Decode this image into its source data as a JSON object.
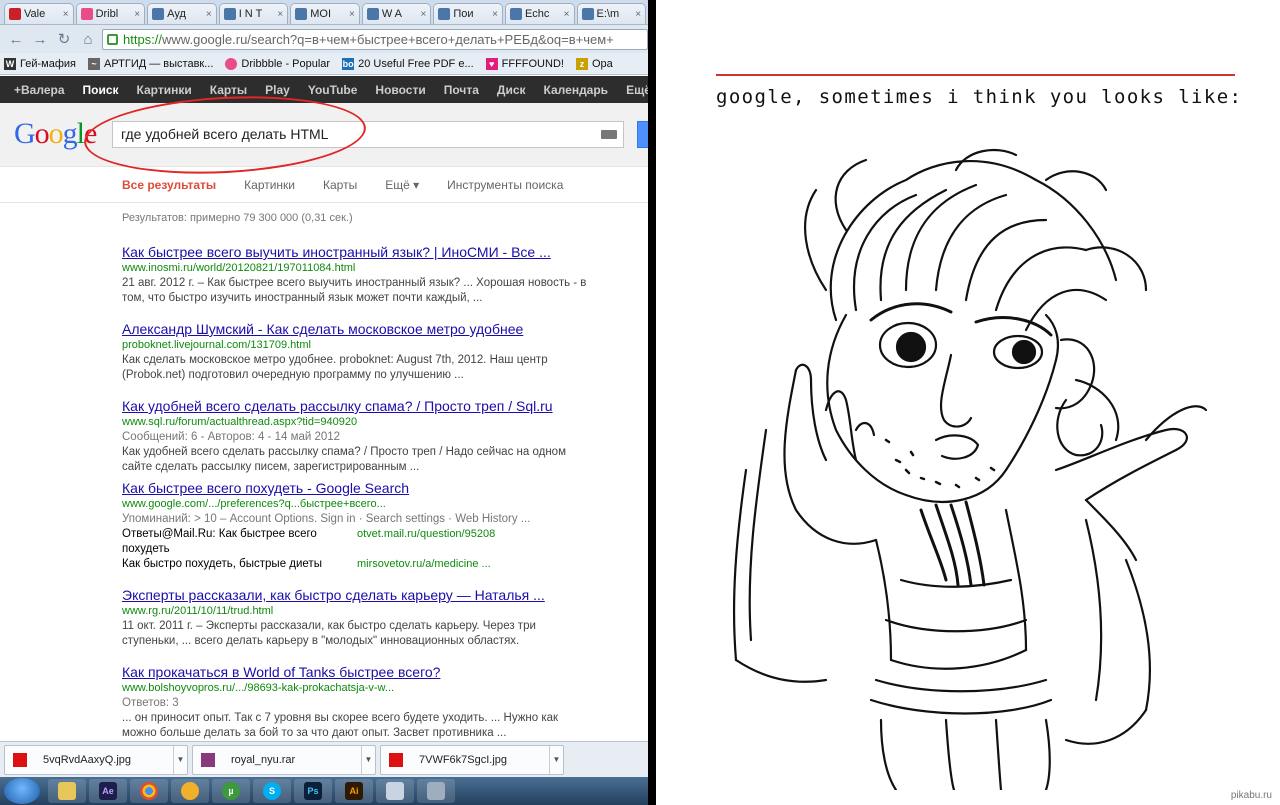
{
  "browser": {
    "tabs": [
      {
        "label": "Vale",
        "color": "#cb2027"
      },
      {
        "label": "Dribl",
        "color": "#ea4c89"
      },
      {
        "label": "Ауд",
        "color": "#4a76a8"
      },
      {
        "label": "I N T",
        "color": "#4a76a8"
      },
      {
        "label": "MOI",
        "color": "#4a76a8"
      },
      {
        "label": "W A",
        "color": "#4a76a8"
      },
      {
        "label": "Пои",
        "color": "#4a76a8"
      },
      {
        "label": "Echc",
        "color": "#4a76a8"
      },
      {
        "label": "E:\\m",
        "color": "#4a76a8"
      }
    ],
    "url_https": "https://",
    "url_rest": "www.google.ru/search?q=в+чем+быстрее+всего+делать+РЕБд&oq=в+чем+",
    "bookmarks": [
      "Гей-мафия",
      "АРТГИД — выставк...",
      "Dribbble - Popular",
      "20 Useful Free PDF e...",
      "FFFFOUND!",
      "Opa"
    ]
  },
  "google_bar": {
    "items": [
      "+Валера",
      "Поиск",
      "Картинки",
      "Карты",
      "Play",
      "YouTube",
      "Новости",
      "Почта",
      "Диск",
      "Календарь",
      "Ещё"
    ]
  },
  "search": {
    "logo": "Google",
    "query": "где удобней всего делать HTML",
    "tabs": [
      "Все результаты",
      "Картинки",
      "Карты",
      "Ещё ▾",
      "Инструменты поиска"
    ],
    "stats": "Результатов: примерно 79 300 000 (0,31 сек.)"
  },
  "results": [
    {
      "title": "Как быстрее всего выучить иностранный язык? | ИноСМИ - Все ...",
      "url": "www.inosmi.ru/world/20120821/197011084.html",
      "meta": "",
      "snippet": "21 авг. 2012 г. – Как быстрее всего выучить иностранный язык? ... Хорошая новость - в том, что быстро изучить иностранный язык может почти каждый, ..."
    },
    {
      "title": "Александр Шумский - Как сделать московское метро удобнее",
      "url": "proboknet.livejournal.com/131709.html",
      "meta": "",
      "snippet": "Как сделать московское метро удобнее. proboknet: August 7th, 2012. Наш центр (Probok.net) подготовил очередную программу по улучшению ..."
    },
    {
      "title": "Как удобней всего сделать рассылку спама? / Просто треп / Sql.ru",
      "url": "www.sql.ru/forum/actualthread.aspx?tid=940920",
      "meta": "Сообщений: 6 - Авторов: 4 - 14 май 2012",
      "snippet": "Как удобней всего сделать рассылку спама? / Просто треп / Надо сейчас на одном сайте сделать рассылку писем, зарегистрированным ..."
    },
    {
      "title": "Как быстрее всего похудеть - Google Search",
      "url": "www.google.com/.../preferences?q...быстрее+всего...",
      "meta": "Упоминаний: > 10 – Account Options. Sign in · Search settings · Web History ...",
      "snippet": ""
    },
    {
      "title": "Эксперты рассказали, как быстро сделать карьеру — Наталья ...",
      "url": "www.rg.ru/2011/10/11/trud.html",
      "meta": "",
      "snippet": "11 окт. 2011 г. – Эксперты рассказали, как быстро сделать карьеру. Через три ступеньки, ... всего делать карьеру в \"молодых\" инновационных областях."
    },
    {
      "title": "Как прокачаться в World of Tanks быстрее всего?",
      "url": "www.bolshoyvopros.ru/.../98693-kak-prokachatsja-v-w...",
      "meta": "Ответов: 3",
      "snippet": "... он приносит опыт. Так с 7 уровня вы скорее всего будете уходить. ... Нужно как можно больше делать за бой то за что дают опыт. Засвет противника ..."
    }
  ],
  "sub_links": {
    "left1": "Ответы@Mail.Ru: Как быстрее всего похудеть",
    "right1": "otvet.mail.ru/question/95208",
    "left2": "Как быстро похудеть, быстрые диеты",
    "right2": "mirsovetov.ru/a/medicine ..."
  },
  "downloads": [
    "5vqRvdAaxyQ.jpg",
    "royal_nyu.rar",
    "7VWF6k7SgcI.jpg"
  ],
  "taskbar": [
    "folder",
    "Ae",
    "chrome",
    "bulb",
    "uT",
    "S",
    "Ps",
    "Ai",
    "doc",
    "calc"
  ],
  "meme": {
    "caption": "google, sometimes i think you looks like:",
    "watermark": "pikabu.ru"
  }
}
